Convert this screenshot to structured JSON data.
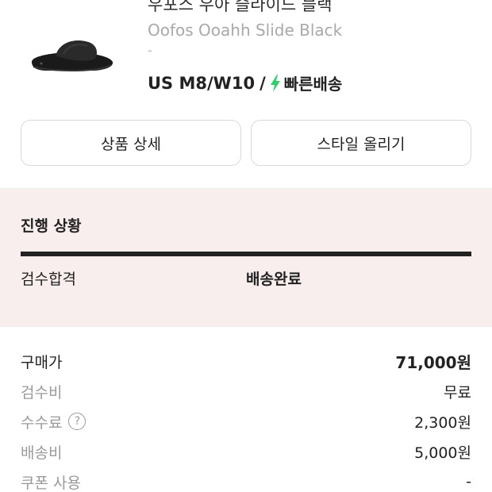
{
  "product": {
    "name_ko": "우포스 우아 슬라이드 블랙",
    "name_en": "Oofos Ooahh Slide Black",
    "sub": "-",
    "size": "US M8/W10",
    "size_sep": "/",
    "fast_delivery": "빠른배송",
    "thumb_icon": "slide-sandal-image",
    "bolt_color": "#2fd06c"
  },
  "buttons": {
    "detail": "상품 상세",
    "style_upload": "스타일 올리기"
  },
  "progress": {
    "title": "진행 상황",
    "step_label": "검수합격",
    "status": "배송완료",
    "bg_color": "#f8eeee"
  },
  "costs": [
    {
      "label": "구매가",
      "value": "71,000원",
      "help": ""
    },
    {
      "label": "검수비",
      "value": "무료",
      "help": ""
    },
    {
      "label": "수수료",
      "value": "2,300원",
      "help": "?"
    },
    {
      "label": "배송비",
      "value": "5,000원",
      "help": ""
    },
    {
      "label": "쿠폰 사용",
      "value": "-",
      "help": ""
    }
  ]
}
